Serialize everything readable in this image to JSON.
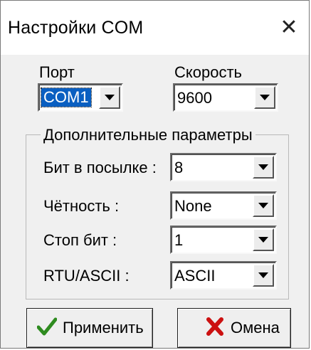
{
  "window": {
    "title": "Настройки COM",
    "close_symbol": "✕"
  },
  "port": {
    "label": "Порт",
    "value": "COM1"
  },
  "speed": {
    "label": "Скорость",
    "value": "9600"
  },
  "group": {
    "title": "Дополнительные параметры",
    "fields": [
      {
        "label": "Бит в посылке :",
        "value": "8"
      },
      {
        "label": "Чётность :",
        "value": "None"
      },
      {
        "label": "Стоп бит :",
        "value": "1"
      },
      {
        "label": "RTU/ASCII :",
        "value": "ASCII"
      }
    ]
  },
  "buttons": {
    "apply": "Применить",
    "cancel": "Омена"
  },
  "colors": {
    "check": "#2e8b1f",
    "cross": "#cc1111",
    "selection": "#0a5fc1"
  }
}
